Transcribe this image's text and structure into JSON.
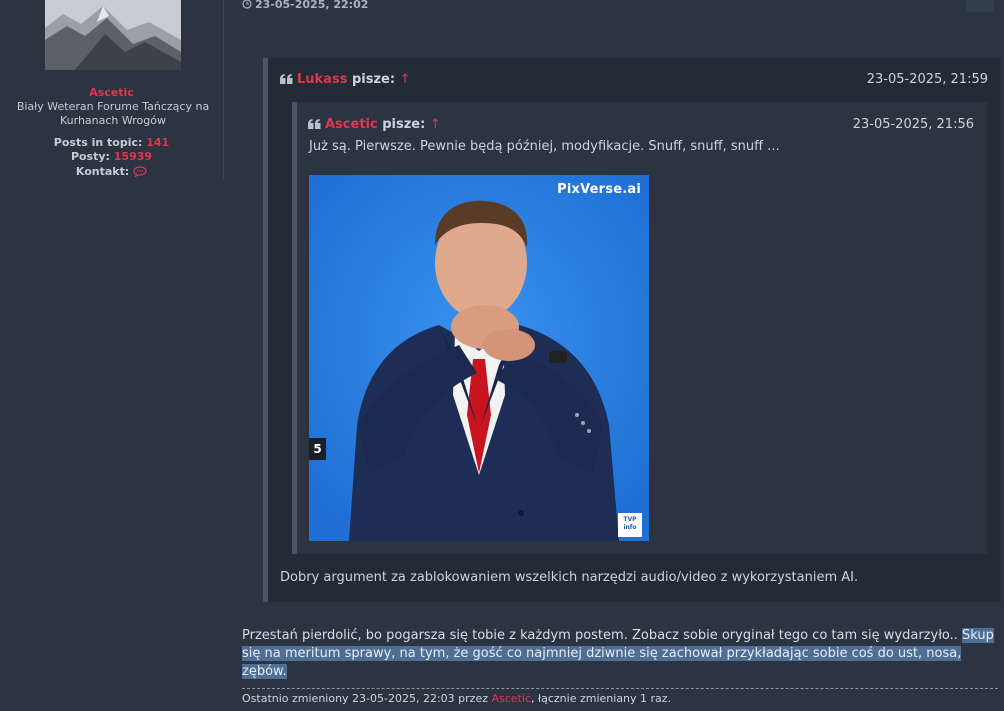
{
  "profile": {
    "name": "Ascetic",
    "rank": "Biały Weteran Forume Tańczący na Kurhanach Wrogów",
    "posts_in_topic_label": "Posts in topic:",
    "posts_in_topic": "141",
    "posty_label": "Posty:",
    "posty": "15939",
    "kontakt_label": "Kontakt:",
    "kontakt_icon": "chat-icon"
  },
  "post": {
    "date": "23-05-2025, 22:02",
    "date_icon": "clock-icon",
    "body_plain": "Przestań pierdolić, bo pogarsza się tobie z każdym postem. Zobacz sobie oryginał tego co tam się wydarzyło.. ",
    "body_selected": "Skup się na meritum sprawy, na tym, że gość co najmniej dziwnie się zachował przykładając sobie coś do ust, nosa, zębów.",
    "edit_prefix": "Ostatnio zmieniony 23-05-2025, 22:03 przez ",
    "edit_user": "Ascetic",
    "edit_suffix": ", łącznie zmieniany 1 raz."
  },
  "quote_outer": {
    "author": "Lukass",
    "says": "pisze:",
    "arrow": "↑",
    "date": "23-05-2025, 21:59",
    "text": "Dobry argument za zablokowaniem wszelkich narzędzi audio/video z wykorzystaniem AI."
  },
  "quote_inner": {
    "author": "Ascetic",
    "says": "pisze:",
    "arrow": "↑",
    "date": "23-05-2025, 21:56",
    "text": "Już są. Pierwsze. Pewnie będą później, modyfikacje. Snuff, snuff, snuff ...",
    "image": {
      "watermark": "PixVerse.ai",
      "badge": "5",
      "logo_line1": "TVP",
      "logo_line2": "info"
    }
  },
  "colors": {
    "background": "#2b3440",
    "quote_bg": "#232b36",
    "accent_red": "#e0364e",
    "selection": "#4f6e94",
    "image_blue": "#2c7fe0"
  }
}
